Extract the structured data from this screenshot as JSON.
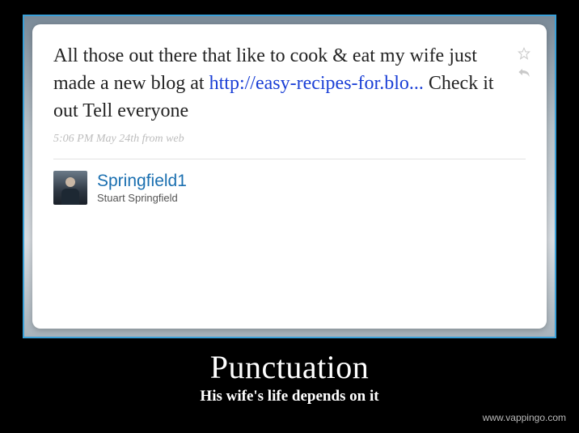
{
  "tweet": {
    "text_before_link": "All those out there that like to cook & eat my wife just made a new blog at ",
    "link_text": "http://easy-recipes-for.blo...",
    "text_after_link": " Check it out Tell everyone",
    "timestamp": "5:06 PM May 24th from web"
  },
  "author": {
    "handle": "Springfield1",
    "realname": "Stuart Springfield"
  },
  "caption": {
    "title": "Punctuation",
    "subtitle": "His wife's life depends on it"
  },
  "watermark": "www.vappingo.com"
}
